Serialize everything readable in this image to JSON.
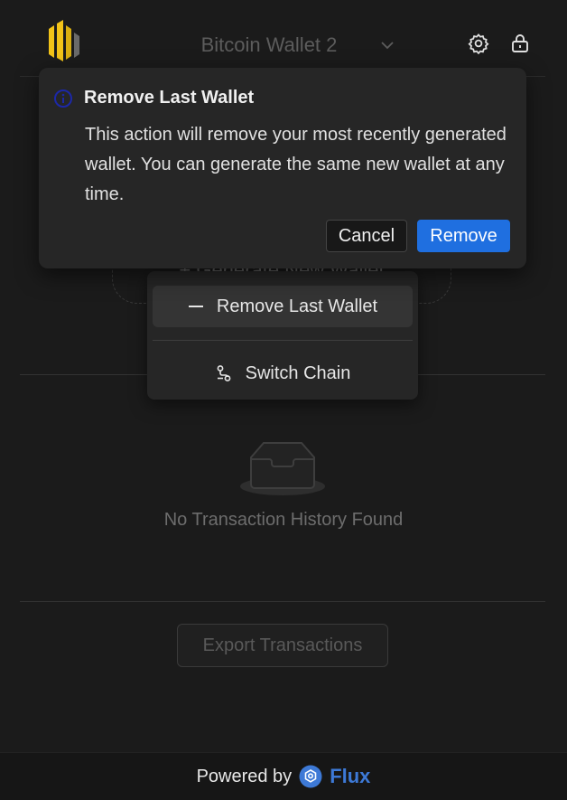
{
  "header": {
    "wallet_name": "Bitcoin Wallet 2",
    "icons": [
      "settings-icon",
      "lock-icon",
      "chevron-down-icon"
    ]
  },
  "background": {
    "generate_button_label": "+ Generate New Wallet"
  },
  "menu": {
    "items": [
      {
        "label": "Remove Last Wallet",
        "icon": "minus-icon",
        "active": true
      },
      {
        "label": "Switch Chain",
        "icon": "switch-chain-icon",
        "active": false
      }
    ]
  },
  "popconfirm": {
    "title": "Remove Last Wallet",
    "description": "This action will remove your most recently generated wallet. You can generate the same new wallet at any time.",
    "cancel_label": "Cancel",
    "confirm_label": "Remove",
    "icon": "info-icon"
  },
  "history": {
    "empty_text": "No Transaction History Found",
    "icon": "empty-inbox-icon"
  },
  "export": {
    "label": "Export Transactions"
  },
  "footer": {
    "powered_by": "Powered by",
    "brand": "Flux",
    "icon": "flux-logo-icon"
  },
  "colors": {
    "accent": "#1f6fe0",
    "brand": "#3d79d6",
    "logo_yellow": "#f2c318",
    "background": "#1b1b1b",
    "panel": "#262626"
  }
}
